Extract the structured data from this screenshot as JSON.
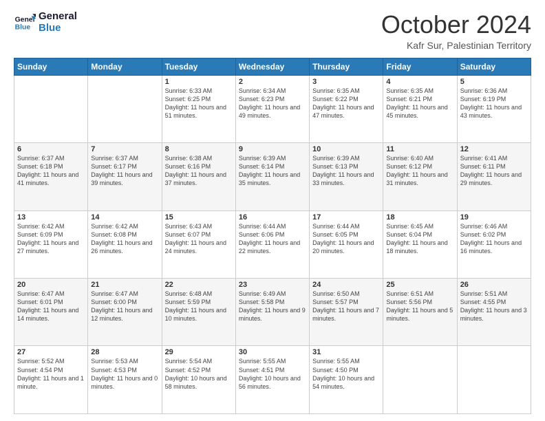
{
  "logo": {
    "line1": "General",
    "line2": "Blue"
  },
  "header": {
    "month": "October 2024",
    "location": "Kafr Sur, Palestinian Territory"
  },
  "days_of_week": [
    "Sunday",
    "Monday",
    "Tuesday",
    "Wednesday",
    "Thursday",
    "Friday",
    "Saturday"
  ],
  "weeks": [
    [
      {
        "day": "",
        "sunrise": "",
        "sunset": "",
        "daylight": ""
      },
      {
        "day": "",
        "sunrise": "",
        "sunset": "",
        "daylight": ""
      },
      {
        "day": "1",
        "sunrise": "Sunrise: 6:33 AM",
        "sunset": "Sunset: 6:25 PM",
        "daylight": "Daylight: 11 hours and 51 minutes."
      },
      {
        "day": "2",
        "sunrise": "Sunrise: 6:34 AM",
        "sunset": "Sunset: 6:23 PM",
        "daylight": "Daylight: 11 hours and 49 minutes."
      },
      {
        "day": "3",
        "sunrise": "Sunrise: 6:35 AM",
        "sunset": "Sunset: 6:22 PM",
        "daylight": "Daylight: 11 hours and 47 minutes."
      },
      {
        "day": "4",
        "sunrise": "Sunrise: 6:35 AM",
        "sunset": "Sunset: 6:21 PM",
        "daylight": "Daylight: 11 hours and 45 minutes."
      },
      {
        "day": "5",
        "sunrise": "Sunrise: 6:36 AM",
        "sunset": "Sunset: 6:19 PM",
        "daylight": "Daylight: 11 hours and 43 minutes."
      }
    ],
    [
      {
        "day": "6",
        "sunrise": "Sunrise: 6:37 AM",
        "sunset": "Sunset: 6:18 PM",
        "daylight": "Daylight: 11 hours and 41 minutes."
      },
      {
        "day": "7",
        "sunrise": "Sunrise: 6:37 AM",
        "sunset": "Sunset: 6:17 PM",
        "daylight": "Daylight: 11 hours and 39 minutes."
      },
      {
        "day": "8",
        "sunrise": "Sunrise: 6:38 AM",
        "sunset": "Sunset: 6:16 PM",
        "daylight": "Daylight: 11 hours and 37 minutes."
      },
      {
        "day": "9",
        "sunrise": "Sunrise: 6:39 AM",
        "sunset": "Sunset: 6:14 PM",
        "daylight": "Daylight: 11 hours and 35 minutes."
      },
      {
        "day": "10",
        "sunrise": "Sunrise: 6:39 AM",
        "sunset": "Sunset: 6:13 PM",
        "daylight": "Daylight: 11 hours and 33 minutes."
      },
      {
        "day": "11",
        "sunrise": "Sunrise: 6:40 AM",
        "sunset": "Sunset: 6:12 PM",
        "daylight": "Daylight: 11 hours and 31 minutes."
      },
      {
        "day": "12",
        "sunrise": "Sunrise: 6:41 AM",
        "sunset": "Sunset: 6:11 PM",
        "daylight": "Daylight: 11 hours and 29 minutes."
      }
    ],
    [
      {
        "day": "13",
        "sunrise": "Sunrise: 6:42 AM",
        "sunset": "Sunset: 6:09 PM",
        "daylight": "Daylight: 11 hours and 27 minutes."
      },
      {
        "day": "14",
        "sunrise": "Sunrise: 6:42 AM",
        "sunset": "Sunset: 6:08 PM",
        "daylight": "Daylight: 11 hours and 26 minutes."
      },
      {
        "day": "15",
        "sunrise": "Sunrise: 6:43 AM",
        "sunset": "Sunset: 6:07 PM",
        "daylight": "Daylight: 11 hours and 24 minutes."
      },
      {
        "day": "16",
        "sunrise": "Sunrise: 6:44 AM",
        "sunset": "Sunset: 6:06 PM",
        "daylight": "Daylight: 11 hours and 22 minutes."
      },
      {
        "day": "17",
        "sunrise": "Sunrise: 6:44 AM",
        "sunset": "Sunset: 6:05 PM",
        "daylight": "Daylight: 11 hours and 20 minutes."
      },
      {
        "day": "18",
        "sunrise": "Sunrise: 6:45 AM",
        "sunset": "Sunset: 6:04 PM",
        "daylight": "Daylight: 11 hours and 18 minutes."
      },
      {
        "day": "19",
        "sunrise": "Sunrise: 6:46 AM",
        "sunset": "Sunset: 6:02 PM",
        "daylight": "Daylight: 11 hours and 16 minutes."
      }
    ],
    [
      {
        "day": "20",
        "sunrise": "Sunrise: 6:47 AM",
        "sunset": "Sunset: 6:01 PM",
        "daylight": "Daylight: 11 hours and 14 minutes."
      },
      {
        "day": "21",
        "sunrise": "Sunrise: 6:47 AM",
        "sunset": "Sunset: 6:00 PM",
        "daylight": "Daylight: 11 hours and 12 minutes."
      },
      {
        "day": "22",
        "sunrise": "Sunrise: 6:48 AM",
        "sunset": "Sunset: 5:59 PM",
        "daylight": "Daylight: 11 hours and 10 minutes."
      },
      {
        "day": "23",
        "sunrise": "Sunrise: 6:49 AM",
        "sunset": "Sunset: 5:58 PM",
        "daylight": "Daylight: 11 hours and 9 minutes."
      },
      {
        "day": "24",
        "sunrise": "Sunrise: 6:50 AM",
        "sunset": "Sunset: 5:57 PM",
        "daylight": "Daylight: 11 hours and 7 minutes."
      },
      {
        "day": "25",
        "sunrise": "Sunrise: 6:51 AM",
        "sunset": "Sunset: 5:56 PM",
        "daylight": "Daylight: 11 hours and 5 minutes."
      },
      {
        "day": "26",
        "sunrise": "Sunrise: 5:51 AM",
        "sunset": "Sunset: 4:55 PM",
        "daylight": "Daylight: 11 hours and 3 minutes."
      }
    ],
    [
      {
        "day": "27",
        "sunrise": "Sunrise: 5:52 AM",
        "sunset": "Sunset: 4:54 PM",
        "daylight": "Daylight: 11 hours and 1 minute."
      },
      {
        "day": "28",
        "sunrise": "Sunrise: 5:53 AM",
        "sunset": "Sunset: 4:53 PM",
        "daylight": "Daylight: 11 hours and 0 minutes."
      },
      {
        "day": "29",
        "sunrise": "Sunrise: 5:54 AM",
        "sunset": "Sunset: 4:52 PM",
        "daylight": "Daylight: 10 hours and 58 minutes."
      },
      {
        "day": "30",
        "sunrise": "Sunrise: 5:55 AM",
        "sunset": "Sunset: 4:51 PM",
        "daylight": "Daylight: 10 hours and 56 minutes."
      },
      {
        "day": "31",
        "sunrise": "Sunrise: 5:55 AM",
        "sunset": "Sunset: 4:50 PM",
        "daylight": "Daylight: 10 hours and 54 minutes."
      },
      {
        "day": "",
        "sunrise": "",
        "sunset": "",
        "daylight": ""
      },
      {
        "day": "",
        "sunrise": "",
        "sunset": "",
        "daylight": ""
      }
    ]
  ]
}
